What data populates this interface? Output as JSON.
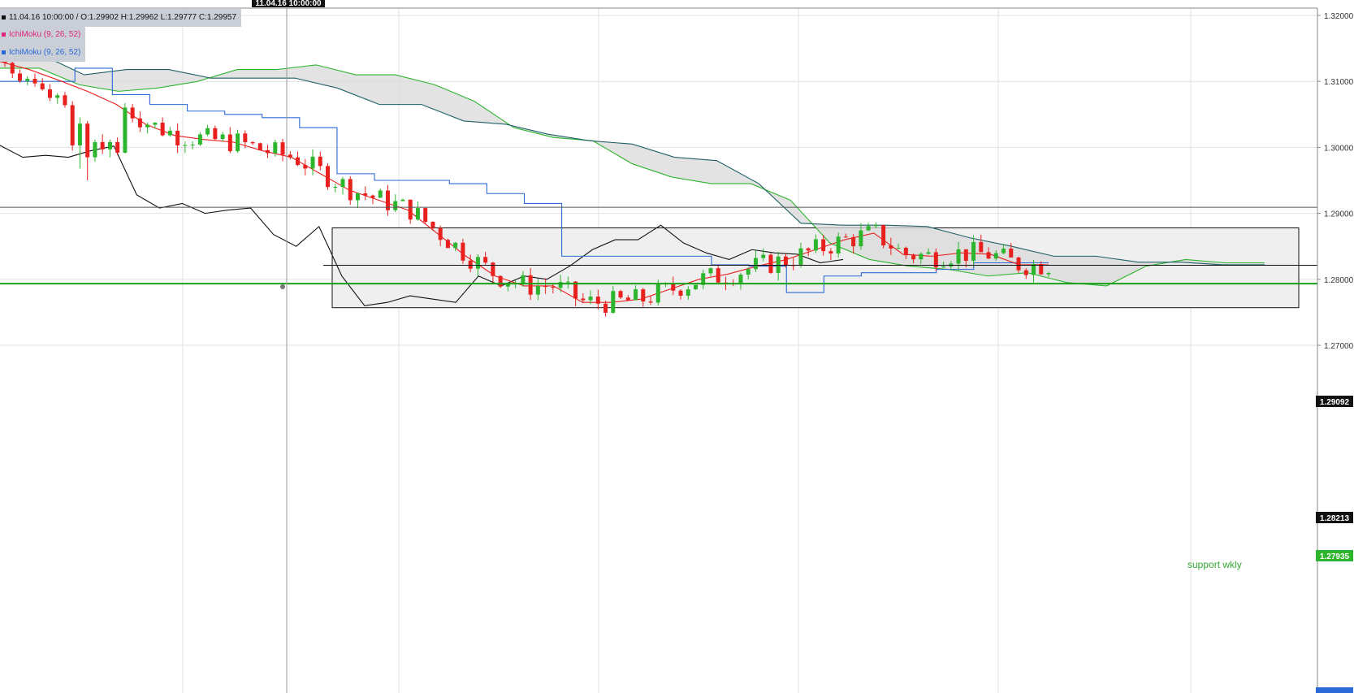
{
  "legend": {
    "ohlc": "11.04.16 10:00:00 / O:1.29902  H:1.29962  L:1.29777  C:1.29957",
    "ichimoku_1": "IchiMoku (9, 26, 52)",
    "ichimoku_2": "IchiMoku (9, 26, 52)"
  },
  "crosshair_date": "11.04.16 10:00:00",
  "price_tags": {
    "horizontal_line": "1.29092",
    "current_price": "1.28213",
    "support": "1.27935"
  },
  "annotation": {
    "support_label": "support wkly"
  },
  "colors": {
    "up_candle": "#2db52d",
    "down_candle": "#e8201e",
    "tenkan": "#e8201e",
    "kijun": "#2b6ad6",
    "senkou_a": "#2db52d",
    "senkou_b": "#1e6066",
    "chikou": "#111111",
    "cloud": "#d9d9d9",
    "support_line": "#1a9e1a",
    "box_fill": "#efefef",
    "ichimoku_1_marker": "#e0267d",
    "ichimoku_2_marker": "#2b6ad6"
  },
  "chart_data": {
    "type": "line",
    "title": "",
    "xlabel": "",
    "ylabel": "",
    "ylim": [
      1.2675,
      1.3215
    ],
    "yticks": [
      "1.32000",
      "1.31000",
      "1.30000",
      "1.29000",
      "1.28000",
      "1.27000"
    ],
    "grid": true,
    "legend_position": "top-left",
    "candles_count": 140,
    "candle_ohlc": [
      {
        "o": 1.3142,
        "h": 1.3152,
        "l": 1.3122,
        "c": 1.3128
      },
      {
        "o": 1.3128,
        "h": 1.3135,
        "l": 1.3105,
        "c": 1.3112
      },
      {
        "o": 1.3112,
        "h": 1.3118,
        "l": 1.3098,
        "c": 1.3101
      },
      {
        "o": 1.3101,
        "h": 1.3108,
        "l": 1.3094,
        "c": 1.3104
      },
      {
        "o": 1.3104,
        "h": 1.3112,
        "l": 1.3092,
        "c": 1.3097
      },
      {
        "o": 1.3097,
        "h": 1.3105,
        "l": 1.3086,
        "c": 1.3088
      },
      {
        "o": 1.3088,
        "h": 1.3096,
        "l": 1.307,
        "c": 1.3075
      },
      {
        "o": 1.3075,
        "h": 1.3082,
        "l": 1.3066,
        "c": 1.3079
      },
      {
        "o": 1.3079,
        "h": 1.3084,
        "l": 1.306,
        "c": 1.3064
      },
      {
        "o": 1.3064,
        "h": 1.307,
        "l": 1.2995,
        "c": 1.3003
      },
      {
        "o": 1.3003,
        "h": 1.3045,
        "l": 1.2968,
        "c": 1.3036
      },
      {
        "o": 1.3036,
        "h": 1.304,
        "l": 1.295,
        "c": 1.2985
      },
      {
        "o": 1.2985,
        "h": 1.3012,
        "l": 1.2978,
        "c": 1.3008
      },
      {
        "o": 1.3008,
        "h": 1.302,
        "l": 1.299,
        "c": 1.2997
      },
      {
        "o": 1.2997,
        "h": 1.3012,
        "l": 1.2985,
        "c": 1.3008
      },
      {
        "o": 1.3008,
        "h": 1.3015,
        "l": 1.2988,
        "c": 1.2992
      }
    ],
    "tenkan_sen": [
      1.313,
      1.3118,
      1.3102,
      1.3085,
      1.3065,
      1.3035,
      1.3018,
      1.3012,
      1.3008,
      1.2995,
      1.2985,
      1.296,
      1.2935,
      1.292,
      1.2905,
      1.287,
      1.2835,
      1.2805,
      1.279,
      1.279,
      1.2765,
      1.2765,
      1.277,
      1.2785,
      1.28,
      1.2808,
      1.282,
      1.283,
      1.2845,
      1.286,
      1.287,
      1.2838,
      1.2835,
      1.284,
      1.2838,
      1.2822,
      1.2822
    ],
    "kijun_sen": [
      1.31,
      1.31,
      1.312,
      1.308,
      1.3065,
      1.3055,
      1.305,
      1.3045,
      1.303,
      1.296,
      1.295,
      1.295,
      1.2945,
      1.293,
      1.2915,
      1.2835,
      1.2835,
      1.2835,
      1.2835,
      1.2822,
      1.282,
      1.278,
      1.2805,
      1.281,
      1.281,
      1.2815,
      1.2825,
      1.2825,
      1.2825
    ],
    "senkou_span_a": [
      1.312,
      1.312,
      1.3095,
      1.3085,
      1.309,
      1.31,
      1.3118,
      1.3118,
      1.3125,
      1.311,
      1.311,
      1.3095,
      1.307,
      1.303,
      1.3015,
      1.301,
      1.2975,
      1.2955,
      1.2945,
      1.2945,
      1.292,
      1.2855,
      1.283,
      1.282,
      1.2815,
      1.2805,
      1.281,
      1.2795,
      1.279,
      1.282,
      1.283,
      1.2825,
      1.2825
    ],
    "senkou_span_b": [
      1.314,
      1.314,
      1.311,
      1.3118,
      1.3118,
      1.3105,
      1.3105,
      1.3105,
      1.309,
      1.3065,
      1.3065,
      1.304,
      1.3035,
      1.302,
      1.301,
      1.3005,
      1.2985,
      1.298,
      1.2945,
      1.2885,
      1.2882,
      1.2882,
      1.288,
      1.2863,
      1.285,
      1.2835,
      1.2835,
      1.2826,
      1.2826,
      1.2822,
      1.2822
    ],
    "chikou_span": [
      1.3003,
      1.2985,
      1.2988,
      1.2985,
      1.2995,
      1.3002,
      1.2928,
      1.2908,
      1.2915,
      1.29,
      1.2905,
      1.2908,
      1.2868,
      1.285,
      1.288,
      1.2805,
      1.276,
      1.2765,
      1.2775,
      1.277,
      1.2765,
      1.2805,
      1.279,
      1.2805,
      1.28,
      1.282,
      1.2845,
      1.286,
      1.286,
      1.2882,
      1.2855,
      1.284,
      1.283,
      1.2845,
      1.284,
      1.2838,
      1.2825,
      1.283
    ],
    "horizontal_levels": [
      {
        "value": 1.29092,
        "label": "1.29092"
      },
      {
        "value": 1.28213,
        "label": "1.28213"
      },
      {
        "value": 1.27935,
        "label": "1.27935",
        "name": "support wkly"
      }
    ],
    "range_box": {
      "top": 1.2878,
      "bottom": 1.2757
    }
  }
}
